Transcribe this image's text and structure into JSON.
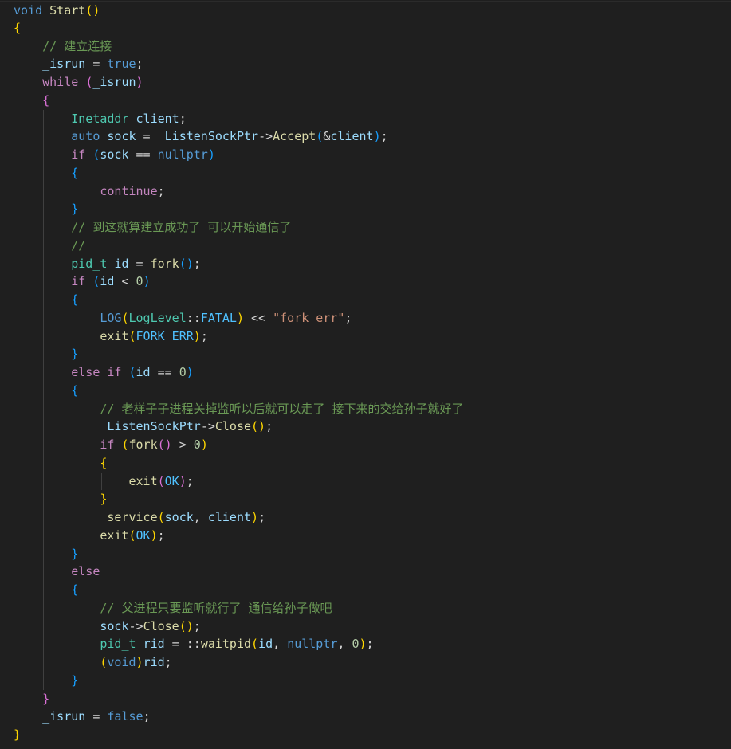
{
  "theme": {
    "background": "#1f1f1f",
    "colors": {
      "kw": "#569cd6",
      "ctrl": "#c586c0",
      "fn": "#dcdcaa",
      "var": "#9cdcfe",
      "type": "#4ec9b0",
      "num": "#b5cea8",
      "str": "#ce9178",
      "com": "#6a9955",
      "op": "#d4d4d4",
      "pun": "#d4d4d4",
      "b1": "#ffd700",
      "b2": "#da70d6",
      "b3": "#179fff",
      "macro": "#569cd6",
      "enum": "#4fc1ff",
      "txt": "#d4d4d4"
    }
  },
  "code": {
    "lines": [
      [
        [
          "kw",
          "void"
        ],
        [
          "txt",
          " "
        ],
        [
          "fn",
          "Start"
        ],
        [
          "b1",
          "()"
        ]
      ],
      [
        [
          "b1",
          "{"
        ]
      ],
      [
        [
          "txt",
          "    "
        ],
        [
          "com",
          "// 建立连接"
        ]
      ],
      [
        [
          "txt",
          "    "
        ],
        [
          "var",
          "_isrun"
        ],
        [
          "op",
          " = "
        ],
        [
          "kw",
          "true"
        ],
        [
          "pun",
          ";"
        ]
      ],
      [
        [
          "txt",
          "    "
        ],
        [
          "ctrl",
          "while"
        ],
        [
          "txt",
          " "
        ],
        [
          "b2",
          "("
        ],
        [
          "var",
          "_isrun"
        ],
        [
          "b2",
          ")"
        ]
      ],
      [
        [
          "txt",
          "    "
        ],
        [
          "b2",
          "{"
        ]
      ],
      [
        [
          "txt",
          "        "
        ],
        [
          "type",
          "Inetaddr"
        ],
        [
          "txt",
          " "
        ],
        [
          "var",
          "client"
        ],
        [
          "pun",
          ";"
        ]
      ],
      [
        [
          "txt",
          "        "
        ],
        [
          "kw",
          "auto"
        ],
        [
          "txt",
          " "
        ],
        [
          "var",
          "sock"
        ],
        [
          "op",
          " = "
        ],
        [
          "var",
          "_ListenSockPtr"
        ],
        [
          "op",
          "->"
        ],
        [
          "fn",
          "Accept"
        ],
        [
          "b3",
          "("
        ],
        [
          "op",
          "&"
        ],
        [
          "var",
          "client"
        ],
        [
          "b3",
          ")"
        ],
        [
          "pun",
          ";"
        ]
      ],
      [
        [
          "txt",
          "        "
        ],
        [
          "ctrl",
          "if"
        ],
        [
          "txt",
          " "
        ],
        [
          "b3",
          "("
        ],
        [
          "var",
          "sock"
        ],
        [
          "op",
          " == "
        ],
        [
          "kw",
          "nullptr"
        ],
        [
          "b3",
          ")"
        ]
      ],
      [
        [
          "txt",
          "        "
        ],
        [
          "b3",
          "{"
        ]
      ],
      [
        [
          "txt",
          "            "
        ],
        [
          "ctrl",
          "continue"
        ],
        [
          "pun",
          ";"
        ]
      ],
      [
        [
          "txt",
          "        "
        ],
        [
          "b3",
          "}"
        ]
      ],
      [
        [
          "txt",
          "        "
        ],
        [
          "com",
          "// 到这就算建立成功了 可以开始通信了"
        ]
      ],
      [
        [
          "txt",
          "        "
        ],
        [
          "com",
          "//"
        ]
      ],
      [
        [
          "txt",
          "        "
        ],
        [
          "type",
          "pid_t"
        ],
        [
          "txt",
          " "
        ],
        [
          "var",
          "id"
        ],
        [
          "op",
          " = "
        ],
        [
          "fn",
          "fork"
        ],
        [
          "b3",
          "()"
        ],
        [
          "pun",
          ";"
        ]
      ],
      [
        [
          "txt",
          "        "
        ],
        [
          "ctrl",
          "if"
        ],
        [
          "txt",
          " "
        ],
        [
          "b3",
          "("
        ],
        [
          "var",
          "id"
        ],
        [
          "op",
          " < "
        ],
        [
          "num",
          "0"
        ],
        [
          "b3",
          ")"
        ]
      ],
      [
        [
          "txt",
          "        "
        ],
        [
          "b3",
          "{"
        ]
      ],
      [
        [
          "txt",
          "            "
        ],
        [
          "macro",
          "LOG"
        ],
        [
          "b1",
          "("
        ],
        [
          "type",
          "LogLevel"
        ],
        [
          "op",
          "::"
        ],
        [
          "enum",
          "FATAL"
        ],
        [
          "b1",
          ")"
        ],
        [
          "op",
          " << "
        ],
        [
          "str",
          "\"fork err\""
        ],
        [
          "pun",
          ";"
        ]
      ],
      [
        [
          "txt",
          "            "
        ],
        [
          "fn",
          "exit"
        ],
        [
          "b1",
          "("
        ],
        [
          "enum",
          "FORK_ERR"
        ],
        [
          "b1",
          ")"
        ],
        [
          "pun",
          ";"
        ]
      ],
      [
        [
          "txt",
          "        "
        ],
        [
          "b3",
          "}"
        ]
      ],
      [
        [
          "txt",
          "        "
        ],
        [
          "ctrl",
          "else"
        ],
        [
          "txt",
          " "
        ],
        [
          "ctrl",
          "if"
        ],
        [
          "txt",
          " "
        ],
        [
          "b3",
          "("
        ],
        [
          "var",
          "id"
        ],
        [
          "op",
          " == "
        ],
        [
          "num",
          "0"
        ],
        [
          "b3",
          ")"
        ]
      ],
      [
        [
          "txt",
          "        "
        ],
        [
          "b3",
          "{"
        ]
      ],
      [
        [
          "txt",
          "            "
        ],
        [
          "com",
          "// 老样子子进程关掉监听以后就可以走了 接下来的交给孙子就好了"
        ]
      ],
      [
        [
          "txt",
          "            "
        ],
        [
          "var",
          "_ListenSockPtr"
        ],
        [
          "op",
          "->"
        ],
        [
          "fn",
          "Close"
        ],
        [
          "b1",
          "()"
        ],
        [
          "pun",
          ";"
        ]
      ],
      [
        [
          "txt",
          "            "
        ],
        [
          "ctrl",
          "if"
        ],
        [
          "txt",
          " "
        ],
        [
          "b1",
          "("
        ],
        [
          "fn",
          "fork"
        ],
        [
          "b2",
          "()"
        ],
        [
          "op",
          " > "
        ],
        [
          "num",
          "0"
        ],
        [
          "b1",
          ")"
        ]
      ],
      [
        [
          "txt",
          "            "
        ],
        [
          "b1",
          "{"
        ]
      ],
      [
        [
          "txt",
          "                "
        ],
        [
          "fn",
          "exit"
        ],
        [
          "b2",
          "("
        ],
        [
          "enum",
          "OK"
        ],
        [
          "b2",
          ")"
        ],
        [
          "pun",
          ";"
        ]
      ],
      [
        [
          "txt",
          "            "
        ],
        [
          "b1",
          "}"
        ]
      ],
      [
        [
          "txt",
          "            "
        ],
        [
          "fn",
          "_service"
        ],
        [
          "b1",
          "("
        ],
        [
          "var",
          "sock"
        ],
        [
          "pun",
          ", "
        ],
        [
          "var",
          "client"
        ],
        [
          "b1",
          ")"
        ],
        [
          "pun",
          ";"
        ]
      ],
      [
        [
          "txt",
          "            "
        ],
        [
          "fn",
          "exit"
        ],
        [
          "b1",
          "("
        ],
        [
          "enum",
          "OK"
        ],
        [
          "b1",
          ")"
        ],
        [
          "pun",
          ";"
        ]
      ],
      [
        [
          "txt",
          "        "
        ],
        [
          "b3",
          "}"
        ]
      ],
      [
        [
          "txt",
          "        "
        ],
        [
          "ctrl",
          "else"
        ]
      ],
      [
        [
          "txt",
          "        "
        ],
        [
          "b3",
          "{"
        ]
      ],
      [
        [
          "txt",
          "            "
        ],
        [
          "com",
          "// 父进程只要监听就行了 通信给孙子做吧"
        ]
      ],
      [
        [
          "txt",
          "            "
        ],
        [
          "var",
          "sock"
        ],
        [
          "op",
          "->"
        ],
        [
          "fn",
          "Close"
        ],
        [
          "b1",
          "()"
        ],
        [
          "pun",
          ";"
        ]
      ],
      [
        [
          "txt",
          "            "
        ],
        [
          "type",
          "pid_t"
        ],
        [
          "txt",
          " "
        ],
        [
          "var",
          "rid"
        ],
        [
          "op",
          " = "
        ],
        [
          "op",
          "::"
        ],
        [
          "fn",
          "waitpid"
        ],
        [
          "b1",
          "("
        ],
        [
          "var",
          "id"
        ],
        [
          "pun",
          ", "
        ],
        [
          "kw",
          "nullptr"
        ],
        [
          "pun",
          ", "
        ],
        [
          "num",
          "0"
        ],
        [
          "b1",
          ")"
        ],
        [
          "pun",
          ";"
        ]
      ],
      [
        [
          "txt",
          "            "
        ],
        [
          "b1",
          "("
        ],
        [
          "kw",
          "void"
        ],
        [
          "b1",
          ")"
        ],
        [
          "var",
          "rid"
        ],
        [
          "pun",
          ";"
        ]
      ],
      [
        [
          "txt",
          "        "
        ],
        [
          "b3",
          "}"
        ]
      ],
      [
        [
          "txt",
          "    "
        ],
        [
          "b2",
          "}"
        ]
      ],
      [
        [
          "txt",
          "    "
        ],
        [
          "var",
          "_isrun"
        ],
        [
          "op",
          " = "
        ],
        [
          "kw",
          "false"
        ],
        [
          "pun",
          ";"
        ]
      ],
      [
        [
          "b1",
          "}"
        ]
      ]
    ]
  }
}
